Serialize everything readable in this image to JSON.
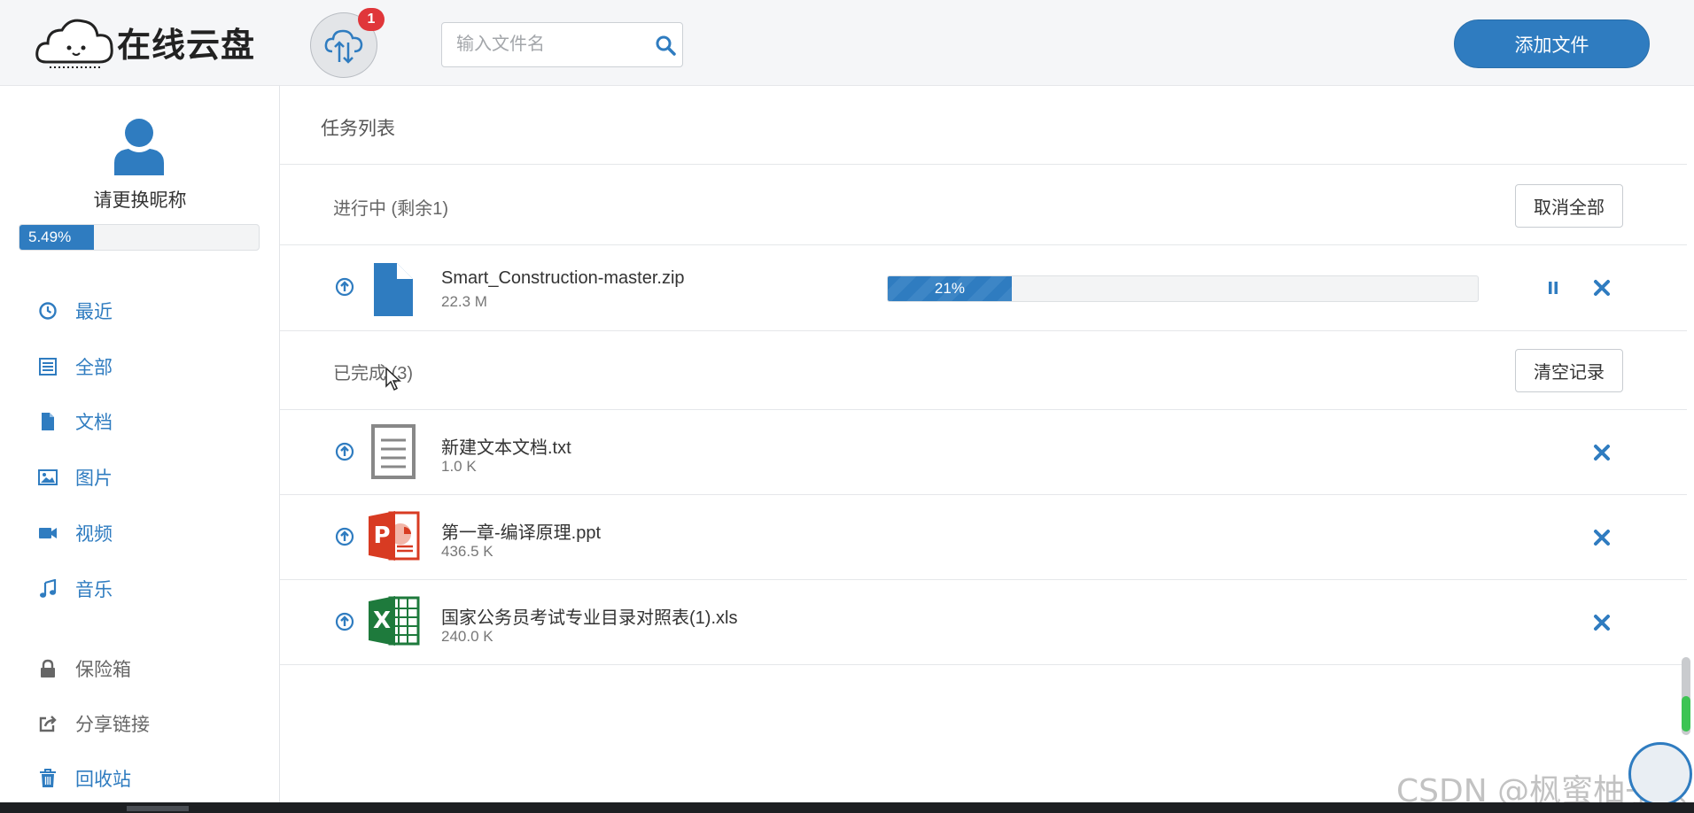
{
  "app": {
    "title": "在线云盘"
  },
  "header": {
    "transfer_badge": "1",
    "search": {
      "placeholder": "输入文件名",
      "value": ""
    },
    "add_label": "添加文件"
  },
  "user": {
    "nickname": "请更换昵称",
    "quota_text": "5.49%",
    "quota_fraction": 0.0549
  },
  "sidebar": {
    "items": [
      {
        "label": "最近",
        "icon": "clock-icon"
      },
      {
        "label": "全部",
        "icon": "list-icon"
      },
      {
        "label": "文档",
        "icon": "document-icon"
      },
      {
        "label": "图片",
        "icon": "image-icon"
      },
      {
        "label": "视频",
        "icon": "video-icon"
      },
      {
        "label": "音乐",
        "icon": "music-icon"
      }
    ],
    "extras": [
      {
        "label": "保险箱",
        "icon": "lock-icon"
      },
      {
        "label": "分享链接",
        "icon": "share-icon"
      },
      {
        "label": "回收站",
        "icon": "trash-icon"
      }
    ]
  },
  "main": {
    "panel_title": "任务列表",
    "in_progress": {
      "header": "进行中 (剩余1)",
      "cancel_all": "取消全部",
      "tasks": [
        {
          "name": "Smart_Construction-master.zip",
          "size": "22.3 M",
          "progress_text": "21%",
          "progress": 0.21,
          "icon": "file-icon"
        }
      ]
    },
    "completed": {
      "header": "已完成 (3)",
      "clear_label": "清空记录",
      "tasks": [
        {
          "name": "新建文本文档.txt",
          "size": "1.0 K",
          "icon": "txt-file-icon"
        },
        {
          "name": "第一章-编译原理.ppt",
          "size": "436.5 K",
          "icon": "ppt-file-icon"
        },
        {
          "name": "国家公务员考试专业目录对照表(1).xls",
          "size": "240.0 K",
          "icon": "xls-file-icon"
        }
      ]
    }
  },
  "watermark": "CSDN @枫蜜柚子茶",
  "colors": {
    "accent": "#2f7cc0",
    "badge": "#e0363a",
    "ppt": "#d83b22",
    "xls": "#1e7a3c"
  }
}
